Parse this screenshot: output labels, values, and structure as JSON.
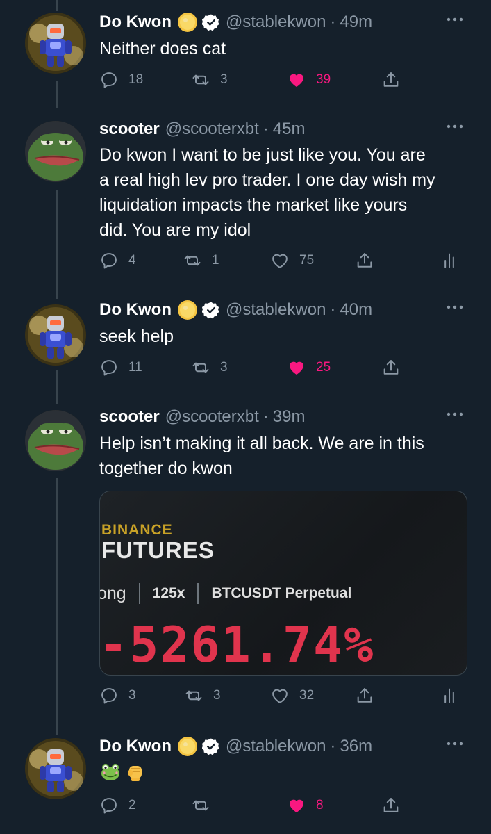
{
  "tweets": [
    {
      "name": "Do Kwon",
      "handle": "@stablekwon",
      "separator": "·",
      "time": "49m",
      "text": "Neither does cat",
      "replies": "18",
      "retweets": "3",
      "likes": "39",
      "liked": true,
      "has_coin": true,
      "verified": true,
      "avatar": "robot-avatar"
    },
    {
      "name": "scooter",
      "handle": "@scooterxbt",
      "separator": "·",
      "time": "45m",
      "text": "Do kwon I want to be just like you. You are\na real high lev pro trader. I one day wish my\nliquidation impacts the market like yours\ndid. You are my idol",
      "replies": "4",
      "retweets": "1",
      "likes": "75",
      "liked": false,
      "avatar": "pepe-avatar"
    },
    {
      "name": "Do Kwon",
      "handle": "@stablekwon",
      "separator": "·",
      "time": "40m",
      "text": "seek help",
      "replies": "11",
      "retweets": "3",
      "likes": "25",
      "liked": true,
      "has_coin": true,
      "verified": true,
      "avatar": "robot-avatar"
    },
    {
      "name": "scooter",
      "handle": "@scooterxbt",
      "separator": "·",
      "time": "39m",
      "text": "Help isn’t making it all back. We are in this\ntogether do kwon",
      "replies": "3",
      "retweets": "3",
      "likes": "32",
      "liked": false,
      "avatar": "pepe-avatar",
      "media": {
        "brand_line1": "BINANCE",
        "brand_line2": "FUTURES",
        "side": "Long",
        "side_visible": "ong",
        "leverage": "125x",
        "pair": "BTCUSDT Perpetual",
        "pnl": "-5261.74%"
      }
    },
    {
      "name": "Do Kwon",
      "handle": "@stablekwon",
      "separator": "·",
      "time": "36m",
      "text": "",
      "emojis": [
        "frog-emoji",
        "raised-fist-emoji"
      ],
      "replies": "2",
      "retweets": "",
      "likes": "8",
      "liked": true,
      "has_coin": true,
      "verified": true,
      "avatar": "robot-avatar"
    }
  ],
  "colors": {
    "background": "#15202b",
    "muted": "#8b98a5",
    "like": "#f91880",
    "thread_line": "#38444d",
    "pnl_red": "#e0344d"
  }
}
